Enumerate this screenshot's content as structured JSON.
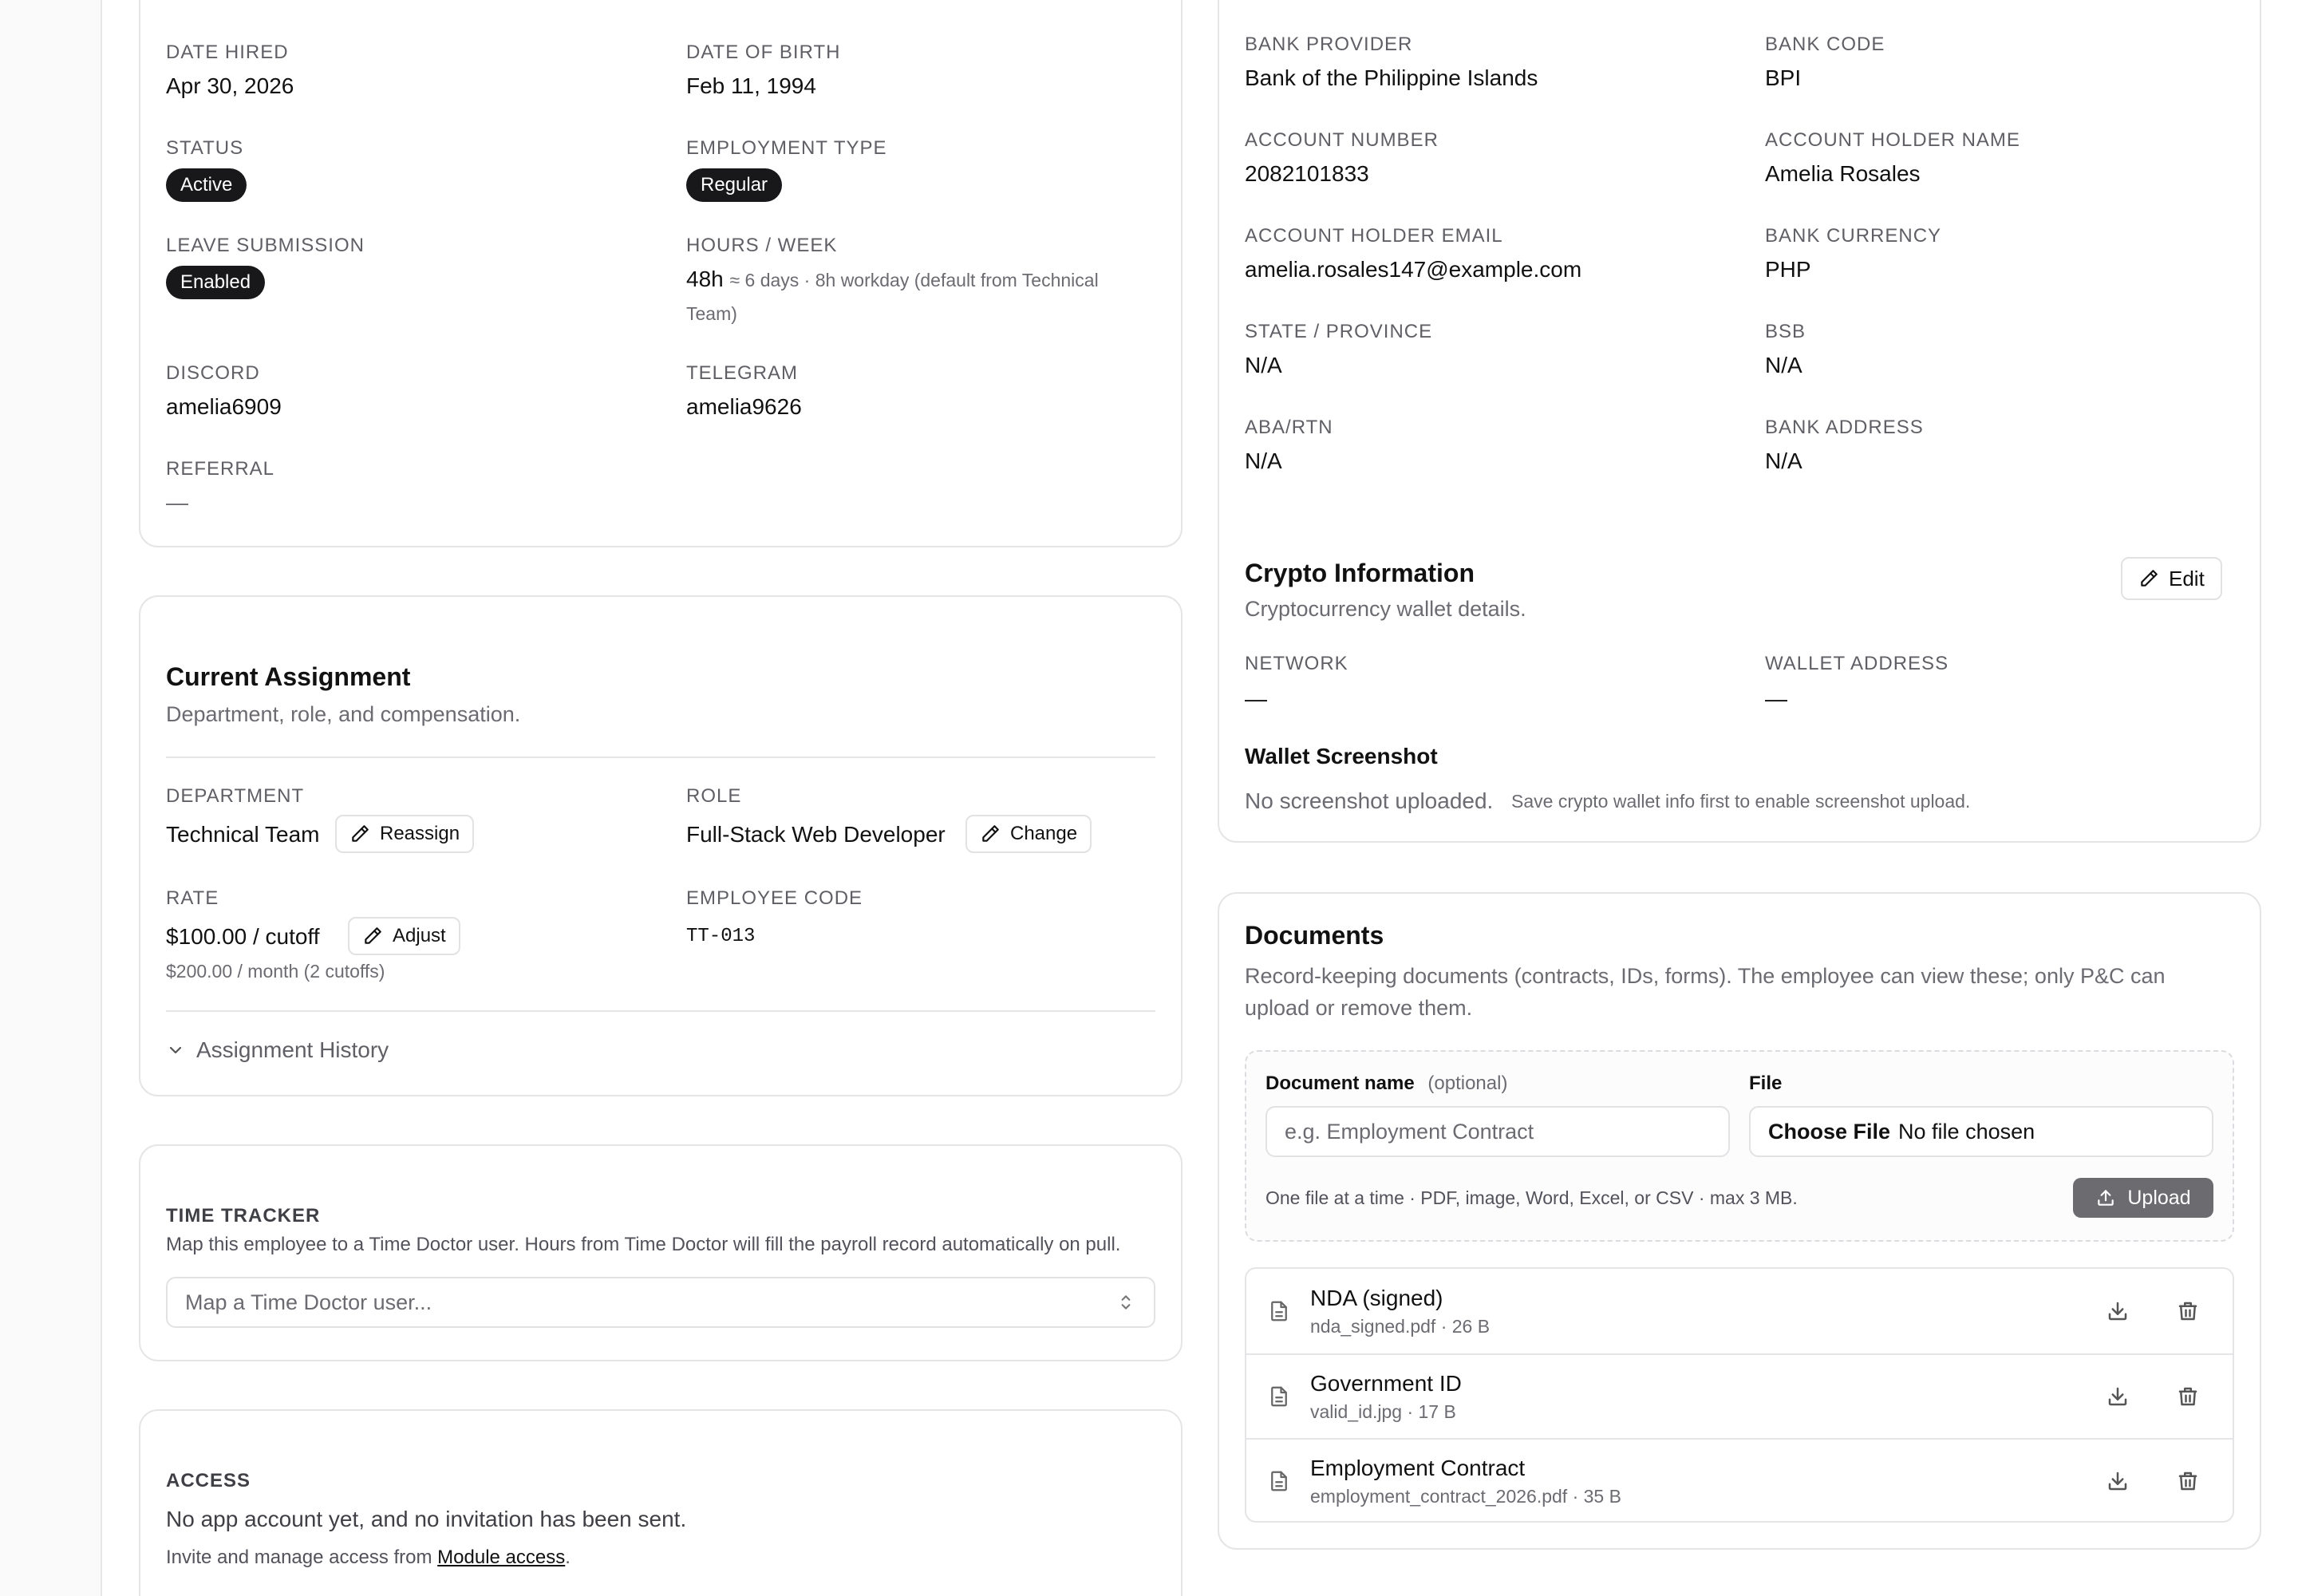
{
  "personal": {
    "date_hired_label": "DATE HIRED",
    "date_hired": "Apr 30, 2026",
    "dob_label": "DATE OF BIRTH",
    "dob": "Feb 11, 1994",
    "status_label": "STATUS",
    "status": "Active",
    "employment_type_label": "EMPLOYMENT TYPE",
    "employment_type": "Regular",
    "leave_label": "LEAVE SUBMISSION",
    "leave": "Enabled",
    "hours_label": "HOURS / WEEK",
    "hours_value": "48h",
    "hours_note_1": "≈ 6 days · 8h workday (default from Technical",
    "hours_note_2": "Team)",
    "discord_label": "DISCORD",
    "discord": "amelia6909",
    "telegram_label": "TELEGRAM",
    "telegram": "amelia9626",
    "referral_label": "REFERRAL",
    "referral": "—"
  },
  "assignment": {
    "title": "Current Assignment",
    "subtitle": "Department, role, and compensation.",
    "department_label": "DEPARTMENT",
    "department": "Technical Team",
    "reassign_label": "Reassign",
    "role_label": "ROLE",
    "role": "Full-Stack Web Developer",
    "change_label": "Change",
    "rate_label": "RATE",
    "rate": "$100.00 / cutoff",
    "adjust_label": "Adjust",
    "rate_monthly": "$200.00 / month (2 cutoffs)",
    "code_label": "EMPLOYEE CODE",
    "code": "TT-013",
    "history_label": "Assignment History"
  },
  "time_tracker": {
    "title": "TIME TRACKER",
    "description": "Map this employee to a Time Doctor user. Hours from Time Doctor will fill the payroll record automatically on pull.",
    "placeholder": "Map a Time Doctor user..."
  },
  "access": {
    "title": "ACCESS",
    "status": "No app account yet, and no invitation has been sent.",
    "note_prefix": "Invite and manage access from ",
    "note_link": "Module access",
    "note_suffix": "."
  },
  "bank": {
    "provider_label": "BANK PROVIDER",
    "provider": "Bank of the Philippine Islands",
    "code_label": "BANK CODE",
    "code": "BPI",
    "account_number_label": "ACCOUNT NUMBER",
    "account_number": "2082101833",
    "holder_name_label": "ACCOUNT HOLDER NAME",
    "holder_name": "Amelia Rosales",
    "holder_email_label": "ACCOUNT HOLDER EMAIL",
    "holder_email": "amelia.rosales147@example.com",
    "currency_label": "BANK CURRENCY",
    "currency": "PHP",
    "state_label": "STATE / PROVINCE",
    "state": "N/A",
    "bsb_label": "BSB",
    "bsb": "N/A",
    "aba_label": "ABA/RTN",
    "aba": "N/A",
    "address_label": "BANK ADDRESS",
    "address": "N/A"
  },
  "crypto": {
    "title": "Crypto Information",
    "subtitle": "Cryptocurrency wallet details.",
    "edit_label": "Edit",
    "network_label": "NETWORK",
    "network": "—",
    "wallet_label": "WALLET ADDRESS",
    "wallet": "—",
    "screenshot_title": "Wallet Screenshot",
    "screenshot_status": "No screenshot uploaded.",
    "screenshot_hint": "Save crypto wallet info first to enable screenshot upload."
  },
  "documents": {
    "title": "Documents",
    "description_1": "Record-keeping documents (contracts, IDs, forms). The employee can view these; only P&C can",
    "description_2": "upload or remove them.",
    "name_label": "Document name",
    "name_optional": "(optional)",
    "name_placeholder": "e.g. Employment Contract",
    "file_label": "File",
    "choose_file": "Choose File",
    "no_file": "No file chosen",
    "hint": "One file at a time · PDF, image, Word, Excel, or CSV · max 3 MB.",
    "upload_label": "Upload",
    "items": [
      {
        "name": "NDA (signed)",
        "meta": "nda_signed.pdf · 26 B"
      },
      {
        "name": "Government ID",
        "meta": "valid_id.jpg · 17 B"
      },
      {
        "name": "Employment Contract",
        "meta": "employment_contract_2026.pdf · 35 B"
      }
    ]
  },
  "icons": {
    "pencil": "pencil-icon",
    "chevron_down": "chevron-down-icon",
    "updown": "chevron-updown-icon",
    "upload": "upload-icon",
    "file": "file-icon",
    "download": "download-icon",
    "trash": "trash-icon"
  },
  "colors": {
    "pill_bg": "#18181b",
    "border": "#e5e5e7",
    "muted": "#6b6b72",
    "upload_bg": "#6b6b70"
  }
}
